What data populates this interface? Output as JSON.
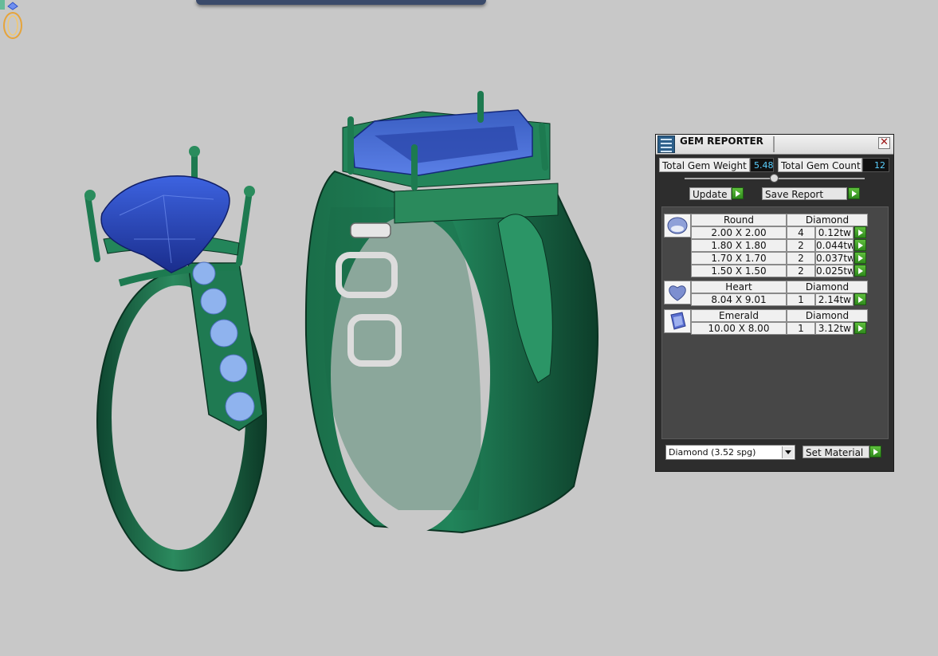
{
  "panel": {
    "title": "GEM REPORTER",
    "close_glyph": "✕",
    "total_weight_label": "Total Gem Weight",
    "total_weight_value": "5.48",
    "total_count_label": "Total Gem Count",
    "total_count_value": "12",
    "update_label": "Update",
    "save_report_label": "Save Report",
    "material_select": "Diamond     (3.52 spg)",
    "set_material_label": "Set Material"
  },
  "groups": [
    {
      "shape": "Round",
      "icon": "round-gem-icon",
      "material": "Diamond",
      "rows": [
        {
          "size": "2.00 X 2.00",
          "count": "4",
          "weight": "0.12tw"
        },
        {
          "size": "1.80 X 1.80",
          "count": "2",
          "weight": "0.044tw"
        },
        {
          "size": "1.70 X 1.70",
          "count": "2",
          "weight": "0.037tw"
        },
        {
          "size": "1.50 X 1.50",
          "count": "2",
          "weight": "0.025tw"
        }
      ]
    },
    {
      "shape": "Heart",
      "icon": "heart-gem-icon",
      "material": "Diamond",
      "rows": [
        {
          "size": "8.04 X 9.01",
          "count": "1",
          "weight": "2.14tw"
        }
      ]
    },
    {
      "shape": "Emerald",
      "icon": "emerald-gem-icon",
      "material": "Diamond",
      "rows": [
        {
          "size": "10.00 X 8.00",
          "count": "1",
          "weight": "3.12tw"
        }
      ]
    }
  ],
  "colors": {
    "viewport_bg": "#c8c8c8",
    "ring_metal": "#1f6b4a",
    "gem_blue": "#2f52c8",
    "accent_stones": "#8fb3ee",
    "value_text": "#5ad0ff"
  }
}
